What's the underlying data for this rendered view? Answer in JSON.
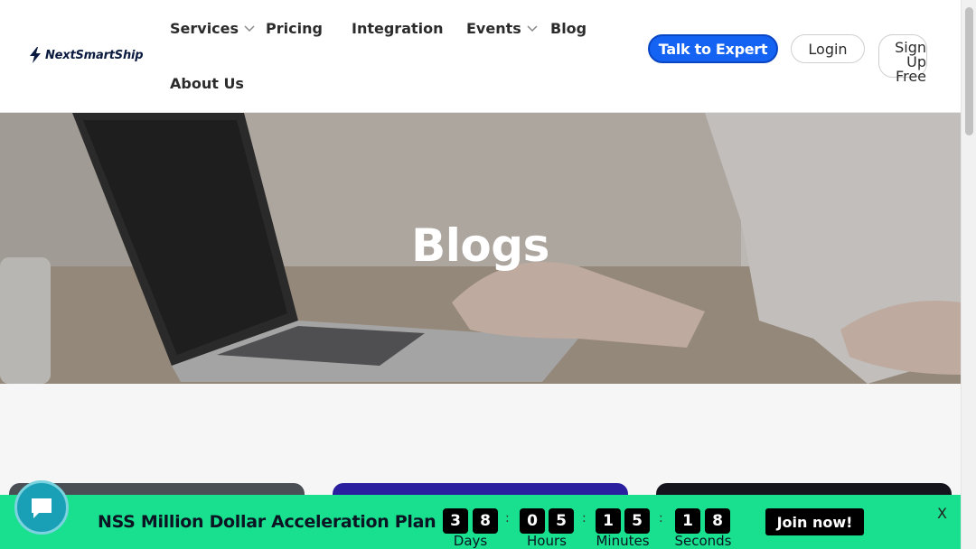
{
  "brand": {
    "name": "NextSmartShip",
    "color": "#0b1b3f",
    "accent": "#1463f3"
  },
  "nav": {
    "services": "Services",
    "pricing": "Pricing",
    "integration": "Integration",
    "events": "Events",
    "blog": "Blog",
    "about": "About Us"
  },
  "actions": {
    "talk": "Talk to Expert",
    "login": "Login",
    "signup_line1": "Sign",
    "signup_line2": "Up Free"
  },
  "hero": {
    "title": "Blogs"
  },
  "promo": {
    "title": "NSS Million Dollar Acceleration Plan",
    "countdown": {
      "days": [
        "3",
        "8"
      ],
      "hours": [
        "0",
        "5"
      ],
      "minutes": [
        "1",
        "5"
      ],
      "seconds": [
        "1",
        "8"
      ]
    },
    "labels": {
      "days": "Days",
      "hours": "Hours",
      "minutes": "Minutes",
      "seconds": "Seconds"
    },
    "join": "Join now!",
    "close": "X",
    "color": "#19e08e"
  },
  "icons": {
    "logo": "lightning-bolt-icon",
    "chevron": "chevron-down-icon",
    "chat": "chat-bubble-icon"
  }
}
